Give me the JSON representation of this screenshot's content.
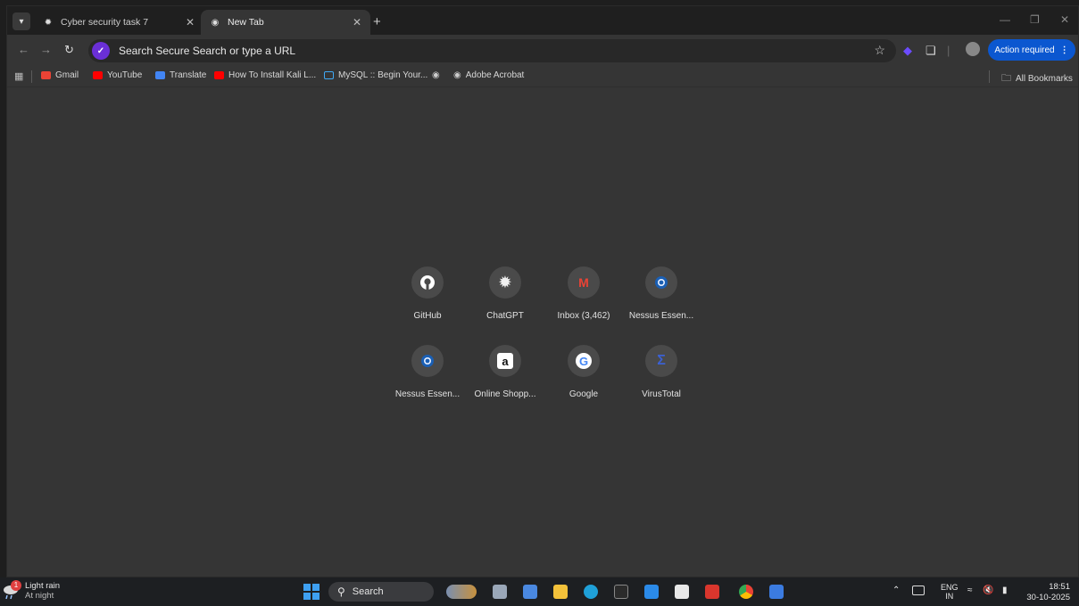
{
  "tabs": [
    {
      "title": "Cyber security task 7",
      "active": false
    },
    {
      "title": "New Tab",
      "active": true
    }
  ],
  "omnibox": {
    "placeholder": "Search Secure Search or type a URL"
  },
  "toolbar": {
    "action_required": "Action required"
  },
  "bookmarks": {
    "items": [
      "Gmail",
      "YouTube",
      "Translate",
      "How To Install Kali L...",
      "MySQL :: Begin Your...",
      "Adobe Acrobat"
    ],
    "all_bookmarks": "All Bookmarks"
  },
  "shortcuts": [
    {
      "label": "GitHub",
      "icon": "github-icon"
    },
    {
      "label": "ChatGPT",
      "icon": "chatgpt-icon"
    },
    {
      "label": "Inbox (3,462)",
      "icon": "gmail-icon"
    },
    {
      "label": "Nessus Essen...",
      "icon": "nessus-icon"
    },
    {
      "label": "Nessus Essen...",
      "icon": "nessus-icon"
    },
    {
      "label": "Online Shopp...",
      "icon": "amazon-icon"
    },
    {
      "label": "Google",
      "icon": "google-icon"
    },
    {
      "label": "VirusTotal",
      "icon": "virustotal-icon"
    }
  ],
  "taskbar": {
    "weather": {
      "condition": "Light rain",
      "time_of_day": "At night",
      "badge": "1"
    },
    "search_label": "Search",
    "language": {
      "lang": "ENG",
      "region": "IN"
    },
    "clock": {
      "time": "18:51",
      "date": "30-10-2025"
    }
  },
  "colors": {
    "accent": "#0b57d0",
    "background": "#353535"
  }
}
